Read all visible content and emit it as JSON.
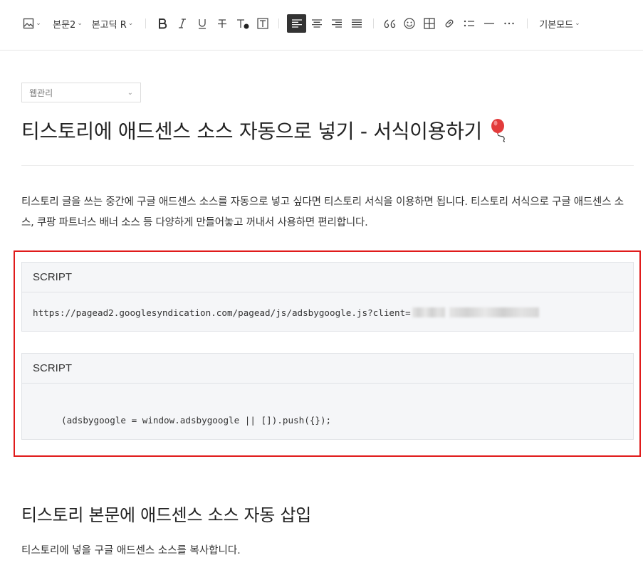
{
  "toolbar": {
    "paragraph_style": "본문2",
    "font": "본고딕 R",
    "mode": "기본모드"
  },
  "post": {
    "category": "웹관리",
    "title": "티스토리에 애드센스 소스 자동으로 넣기 - 서식이용하기",
    "intro": "티스토리 글을 쓰는 중간에 구글 애드센스 소스를 자동으로 넣고 싶다면 티스토리 서식을 이용하면 됩니다. 티스토리 서식으로 구글 애드센스 소스, 쿠팡 파트너스 배너 소스 등 다양하게 만들어놓고 꺼내서 사용하면 편리합니다.",
    "code_blocks": [
      {
        "label": "SCRIPT",
        "code": "https://pagead2.googlesyndication.com/pagead/js/adsbygoogle.js?client="
      },
      {
        "label": "SCRIPT",
        "code": "(adsbygoogle = window.adsbygoogle || []).push({});"
      }
    ],
    "section_heading": "티스토리 본문에 애드센스 소스 자동 삽입",
    "section_text": "티스토리에 넣을 구글 애드센스 소스를 복사합니다."
  },
  "colors": {
    "highlight_border": "#e01b1b",
    "code_bg": "#f5f6f8",
    "active_tool": "#333333"
  },
  "icons": [
    "image-icon",
    "bold-icon",
    "italic-icon",
    "underline-icon",
    "strikethrough-icon",
    "text-color-icon",
    "text-background-icon",
    "align-left-icon",
    "align-center-icon",
    "align-right-icon",
    "align-justify-icon",
    "quote-icon",
    "emoji-icon",
    "table-icon",
    "link-icon",
    "list-icon",
    "divider-icon",
    "more-icon",
    "balloon-icon"
  ]
}
